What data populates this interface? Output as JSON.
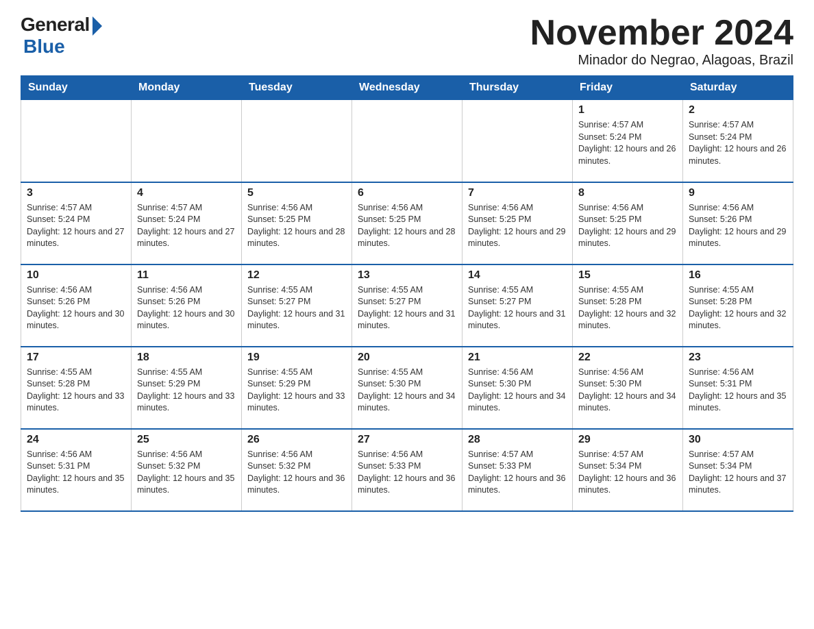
{
  "logo": {
    "general": "General",
    "blue": "Blue"
  },
  "title": "November 2024",
  "subtitle": "Minador do Negrao, Alagoas, Brazil",
  "days_of_week": [
    "Sunday",
    "Monday",
    "Tuesday",
    "Wednesday",
    "Thursday",
    "Friday",
    "Saturday"
  ],
  "weeks": [
    [
      {
        "day": "",
        "info": ""
      },
      {
        "day": "",
        "info": ""
      },
      {
        "day": "",
        "info": ""
      },
      {
        "day": "",
        "info": ""
      },
      {
        "day": "",
        "info": ""
      },
      {
        "day": "1",
        "info": "Sunrise: 4:57 AM\nSunset: 5:24 PM\nDaylight: 12 hours and 26 minutes."
      },
      {
        "day": "2",
        "info": "Sunrise: 4:57 AM\nSunset: 5:24 PM\nDaylight: 12 hours and 26 minutes."
      }
    ],
    [
      {
        "day": "3",
        "info": "Sunrise: 4:57 AM\nSunset: 5:24 PM\nDaylight: 12 hours and 27 minutes."
      },
      {
        "day": "4",
        "info": "Sunrise: 4:57 AM\nSunset: 5:24 PM\nDaylight: 12 hours and 27 minutes."
      },
      {
        "day": "5",
        "info": "Sunrise: 4:56 AM\nSunset: 5:25 PM\nDaylight: 12 hours and 28 minutes."
      },
      {
        "day": "6",
        "info": "Sunrise: 4:56 AM\nSunset: 5:25 PM\nDaylight: 12 hours and 28 minutes."
      },
      {
        "day": "7",
        "info": "Sunrise: 4:56 AM\nSunset: 5:25 PM\nDaylight: 12 hours and 29 minutes."
      },
      {
        "day": "8",
        "info": "Sunrise: 4:56 AM\nSunset: 5:25 PM\nDaylight: 12 hours and 29 minutes."
      },
      {
        "day": "9",
        "info": "Sunrise: 4:56 AM\nSunset: 5:26 PM\nDaylight: 12 hours and 29 minutes."
      }
    ],
    [
      {
        "day": "10",
        "info": "Sunrise: 4:56 AM\nSunset: 5:26 PM\nDaylight: 12 hours and 30 minutes."
      },
      {
        "day": "11",
        "info": "Sunrise: 4:56 AM\nSunset: 5:26 PM\nDaylight: 12 hours and 30 minutes."
      },
      {
        "day": "12",
        "info": "Sunrise: 4:55 AM\nSunset: 5:27 PM\nDaylight: 12 hours and 31 minutes."
      },
      {
        "day": "13",
        "info": "Sunrise: 4:55 AM\nSunset: 5:27 PM\nDaylight: 12 hours and 31 minutes."
      },
      {
        "day": "14",
        "info": "Sunrise: 4:55 AM\nSunset: 5:27 PM\nDaylight: 12 hours and 31 minutes."
      },
      {
        "day": "15",
        "info": "Sunrise: 4:55 AM\nSunset: 5:28 PM\nDaylight: 12 hours and 32 minutes."
      },
      {
        "day": "16",
        "info": "Sunrise: 4:55 AM\nSunset: 5:28 PM\nDaylight: 12 hours and 32 minutes."
      }
    ],
    [
      {
        "day": "17",
        "info": "Sunrise: 4:55 AM\nSunset: 5:28 PM\nDaylight: 12 hours and 33 minutes."
      },
      {
        "day": "18",
        "info": "Sunrise: 4:55 AM\nSunset: 5:29 PM\nDaylight: 12 hours and 33 minutes."
      },
      {
        "day": "19",
        "info": "Sunrise: 4:55 AM\nSunset: 5:29 PM\nDaylight: 12 hours and 33 minutes."
      },
      {
        "day": "20",
        "info": "Sunrise: 4:55 AM\nSunset: 5:30 PM\nDaylight: 12 hours and 34 minutes."
      },
      {
        "day": "21",
        "info": "Sunrise: 4:56 AM\nSunset: 5:30 PM\nDaylight: 12 hours and 34 minutes."
      },
      {
        "day": "22",
        "info": "Sunrise: 4:56 AM\nSunset: 5:30 PM\nDaylight: 12 hours and 34 minutes."
      },
      {
        "day": "23",
        "info": "Sunrise: 4:56 AM\nSunset: 5:31 PM\nDaylight: 12 hours and 35 minutes."
      }
    ],
    [
      {
        "day": "24",
        "info": "Sunrise: 4:56 AM\nSunset: 5:31 PM\nDaylight: 12 hours and 35 minutes."
      },
      {
        "day": "25",
        "info": "Sunrise: 4:56 AM\nSunset: 5:32 PM\nDaylight: 12 hours and 35 minutes."
      },
      {
        "day": "26",
        "info": "Sunrise: 4:56 AM\nSunset: 5:32 PM\nDaylight: 12 hours and 36 minutes."
      },
      {
        "day": "27",
        "info": "Sunrise: 4:56 AM\nSunset: 5:33 PM\nDaylight: 12 hours and 36 minutes."
      },
      {
        "day": "28",
        "info": "Sunrise: 4:57 AM\nSunset: 5:33 PM\nDaylight: 12 hours and 36 minutes."
      },
      {
        "day": "29",
        "info": "Sunrise: 4:57 AM\nSunset: 5:34 PM\nDaylight: 12 hours and 36 minutes."
      },
      {
        "day": "30",
        "info": "Sunrise: 4:57 AM\nSunset: 5:34 PM\nDaylight: 12 hours and 37 minutes."
      }
    ]
  ]
}
